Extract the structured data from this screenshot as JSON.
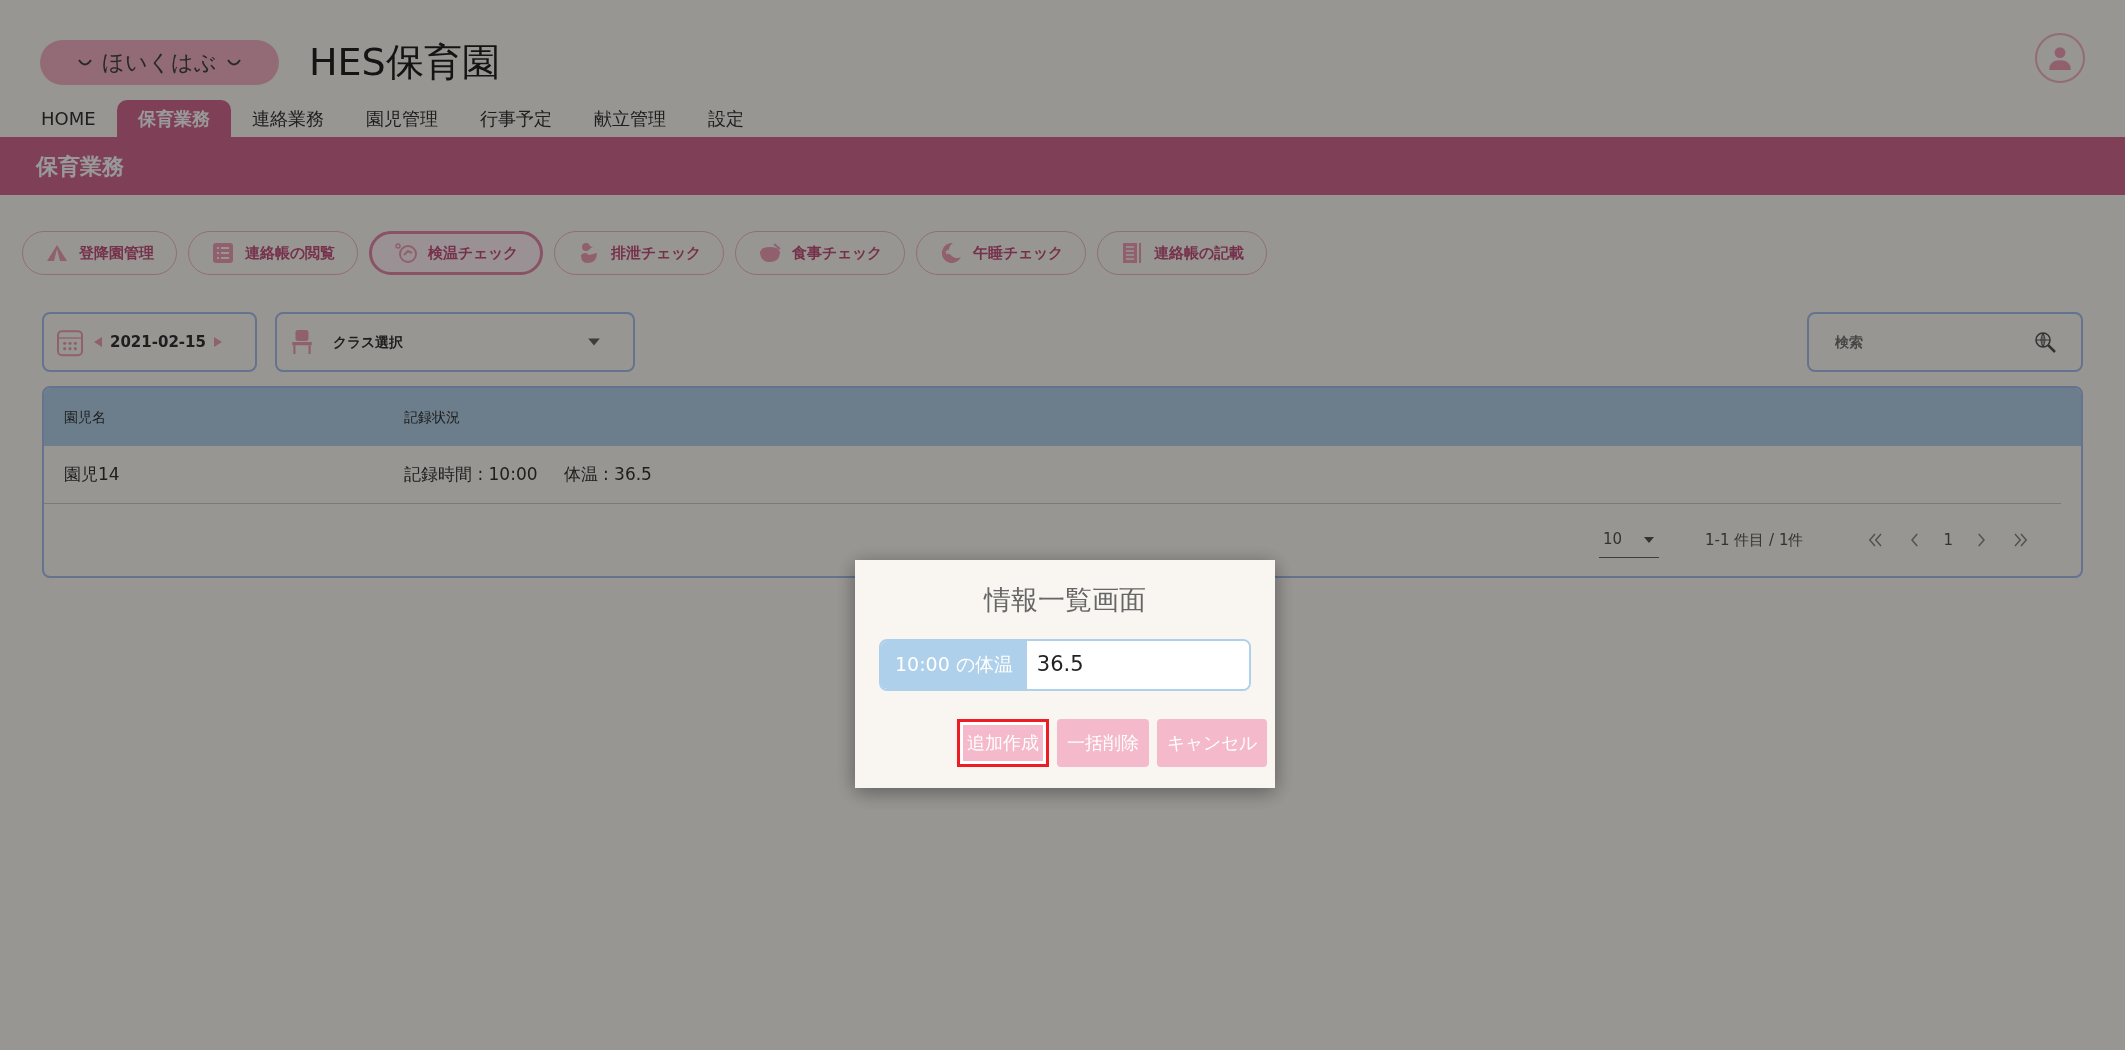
{
  "logo": {
    "text": "ほいくはぶ"
  },
  "site_title": "HES保育園",
  "tabs": [
    {
      "label": "HOME",
      "selected": false
    },
    {
      "label": "保育業務",
      "selected": true
    },
    {
      "label": "連絡業務",
      "selected": false
    },
    {
      "label": "園児管理",
      "selected": false
    },
    {
      "label": "行事予定",
      "selected": false
    },
    {
      "label": "献立管理",
      "selected": false
    },
    {
      "label": "設定",
      "selected": false
    }
  ],
  "page_banner": "保育業務",
  "actions": [
    {
      "label": "登降園管理",
      "kind": "tent",
      "selected": false
    },
    {
      "label": "連絡帳の閲覧",
      "kind": "list",
      "selected": false
    },
    {
      "label": "検温チェック",
      "kind": "thermo",
      "selected": true
    },
    {
      "label": "排泄チェック",
      "kind": "duck",
      "selected": false
    },
    {
      "label": "食事チェック",
      "kind": "bowl",
      "selected": false
    },
    {
      "label": "午睡チェック",
      "kind": "moon",
      "selected": false
    },
    {
      "label": "連絡帳の記載",
      "kind": "notebook",
      "selected": false
    }
  ],
  "date_picker": {
    "value": "2021-02-15"
  },
  "class_select": {
    "placeholder": "クラス選択"
  },
  "search": {
    "placeholder": "検索"
  },
  "table": {
    "columns": [
      "園児名",
      "記録状況"
    ],
    "rows": [
      {
        "name": "園児14",
        "records": [
          "記録時間 : 10:00",
          "体温 : 36.5"
        ]
      }
    ]
  },
  "pagination": {
    "page_size": "10",
    "range": "1-1 件目 / 1件",
    "current_page": "1"
  },
  "modal": {
    "open": true,
    "title": "情報一覧画面",
    "field": {
      "label": "10:00 の体温",
      "value": "36.5"
    },
    "buttons": [
      {
        "label": "追加作成",
        "highlighted": true
      },
      {
        "label": "一括削除",
        "highlighted": false
      },
      {
        "label": "キャンセル",
        "highlighted": false
      }
    ]
  }
}
